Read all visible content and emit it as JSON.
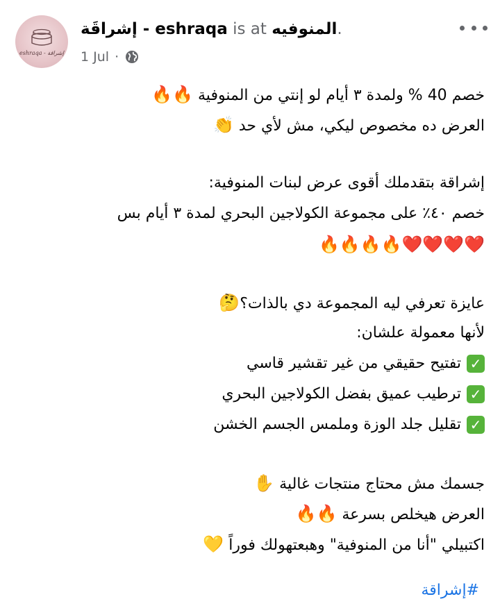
{
  "header": {
    "page_name": "إشراقَة - eshraqa",
    "is_at": " is at ",
    "place": "المنوفيه",
    "period": ".",
    "date": "1 Jul",
    "dot": "·",
    "avatar_text": "eshraqa - إشراقة",
    "icons": {
      "privacy": "globe-icon",
      "menu": "more-options-icon"
    }
  },
  "post": {
    "lines": [
      {
        "text": "خصم 40 % ولمدة ٣ أيام لو إنتي من المنوفية",
        "emoji": "🔥🔥"
      },
      {
        "text": "العرض ده مخصوص ليكي، مش لأي حد",
        "emoji": "👏"
      },
      {
        "text": "إشراقة بتقدملك أقوى عرض لبنات المنوفية:",
        "emoji": ""
      },
      {
        "text": "خصم ٤٠٪ على مجموعة الكولاجين البحري لمدة ٣ أيام بس",
        "emoji": ""
      },
      {
        "text": "",
        "emoji": "❤️❤️❤️❤️🔥🔥🔥🔥"
      },
      {
        "text": "عايزة تعرفي ليه المجموعة دي بالذات؟",
        "emoji": "🤔"
      },
      {
        "text": "لأنها معمولة علشان:",
        "emoji": ""
      },
      {
        "text": "تفتيح حقيقي من غير تقشير قاسي",
        "check": "✓"
      },
      {
        "text": "ترطيب عميق بفضل الكولاجين البحري",
        "check": "✓"
      },
      {
        "text": "تقليل جلد الوزة وملمس الجسم الخشن",
        "check": "✓"
      },
      {
        "text": "جسمك مش محتاج منتجات غالية",
        "emoji": "✋"
      },
      {
        "text": "العرض هيخلص بسرعة",
        "emoji": "🔥🔥"
      },
      {
        "text": "اكتبيلي \"أنا من المنوفية\" وهبعتهولك فوراً",
        "emoji": "💛"
      }
    ],
    "footer_link": "#إشراقة"
  }
}
